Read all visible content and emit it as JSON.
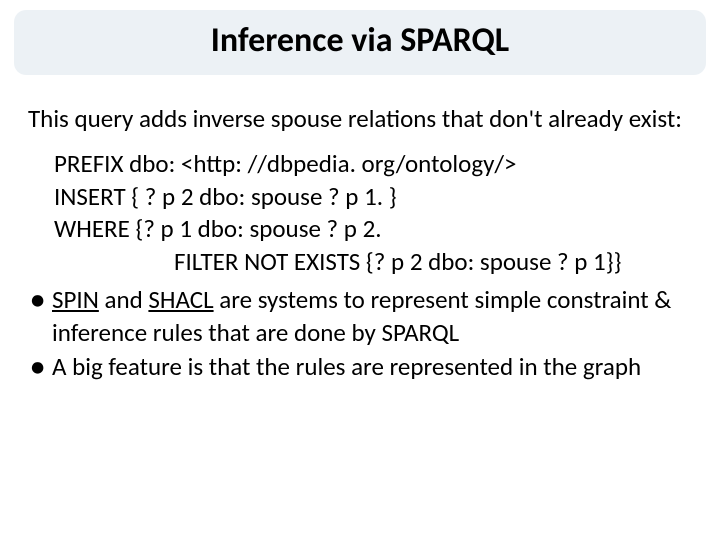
{
  "title": "Inference via SPARQL",
  "intro": "This query adds inverse spouse relations that don't already exist:",
  "code": {
    "l1": "PREFIX dbo: <http: //dbpedia. org/ontology/>",
    "l2": "INSERT { ? p 2 dbo: spouse ? p 1. }",
    "l3": "WHERE {? p 1 dbo: spouse ? p 2.",
    "l4": "FILTER NOT EXISTS {? p 2 dbo: spouse ? p 1}}"
  },
  "bullets": {
    "b1": {
      "spin": "SPIN",
      "and": " and ",
      "shacl": "SHACL",
      "rest": " are systems to represent simple constraint & inference rules that are done by SPARQL"
    },
    "b2": "A big feature is that the rules are represented in the graph"
  }
}
